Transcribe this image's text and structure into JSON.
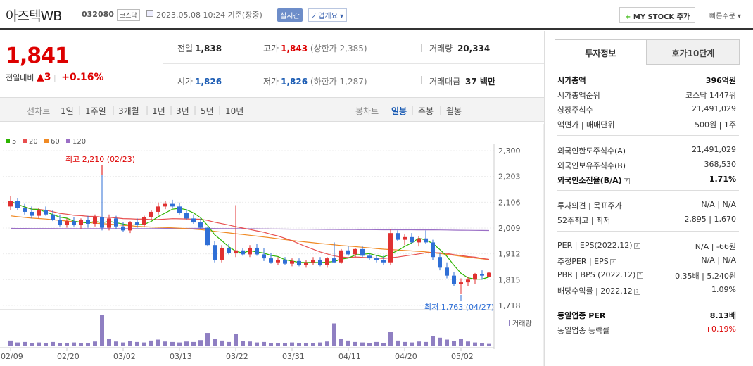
{
  "header": {
    "name": "아즈텍WB",
    "code": "032080",
    "market": "코스닥",
    "timestamp": "2023.05.08 10:24 기준(장중)",
    "realtime": "실시간",
    "company_info": "기업개요",
    "my_stock": "MY STOCK 추가",
    "quick_order": "빠른주문"
  },
  "price": {
    "current": "1,841",
    "change_label": "전일대비",
    "change": "3",
    "change_pct": "+0.16%"
  },
  "quote": {
    "prev_close_label": "전일",
    "prev_close": "1,838",
    "high_label": "고가",
    "high": "1,843",
    "upper_limit": "(상한가 2,385)",
    "volume_label": "거래량",
    "volume": "20,334",
    "open_label": "시가",
    "open": "1,826",
    "low_label": "저가",
    "low": "1,826",
    "lower_limit": "(하한가 1,287)",
    "amount_label": "거래대금",
    "amount": "37 백만"
  },
  "period_bar": {
    "line_label": "선차트",
    "line_periods": [
      "1일",
      "1주일",
      "3개월",
      "1년",
      "3년",
      "5년",
      "10년"
    ],
    "candle_label": "봉차트",
    "candle_periods": [
      "일봉",
      "주봉",
      "월봉"
    ],
    "active_candle": "일봉"
  },
  "chart_data": {
    "type": "candlestick",
    "legend": [
      {
        "name": "5",
        "color": "#2db400"
      },
      {
        "name": "20",
        "color": "#e84f4f"
      },
      {
        "name": "60",
        "color": "#f08a24"
      },
      {
        "name": "120",
        "color": "#9b6fc6"
      }
    ],
    "y_ticks": [
      "2,300",
      "2,203",
      "2,106",
      "2,009",
      "1,912",
      "1,815",
      "1,718"
    ],
    "ylim": [
      1718,
      2300
    ],
    "x_ticks": [
      "02/09",
      "02/20",
      "03/02",
      "03/13",
      "03/22",
      "03/31",
      "04/11",
      "04/20",
      "05/02"
    ],
    "high_annotation": "최고 2,210 (02/23)",
    "low_annotation": "최저 1,763 (04/27)",
    "volume_label": "거래량",
    "candles": [
      [
        2090,
        2130,
        2075,
        2110
      ],
      [
        2110,
        2120,
        2075,
        2085
      ],
      [
        2085,
        2100,
        2060,
        2070
      ],
      [
        2070,
        2090,
        2045,
        2055
      ],
      [
        2055,
        2085,
        2045,
        2075
      ],
      [
        2075,
        2090,
        2055,
        2060
      ],
      [
        2060,
        2075,
        2035,
        2040
      ],
      [
        2040,
        2060,
        2015,
        2020
      ],
      [
        2020,
        2045,
        2010,
        2035
      ],
      [
        2035,
        2050,
        2015,
        2020
      ],
      [
        2020,
        2045,
        2005,
        2040
      ],
      [
        2040,
        2055,
        2010,
        2025
      ],
      [
        2025,
        2060,
        2015,
        2050
      ],
      [
        2050,
        2210,
        2000,
        2010
      ],
      [
        2010,
        2060,
        2000,
        2045
      ],
      [
        2045,
        2055,
        2005,
        2015
      ],
      [
        2015,
        2030,
        1995,
        2000
      ],
      [
        2000,
        2035,
        1990,
        2030
      ],
      [
        2030,
        2045,
        2010,
        2020
      ],
      [
        2020,
        2055,
        2015,
        2050
      ],
      [
        2050,
        2075,
        2040,
        2070
      ],
      [
        2070,
        2105,
        2060,
        2090
      ],
      [
        2090,
        2110,
        2080,
        2100
      ],
      [
        2100,
        2115,
        2085,
        2090
      ],
      [
        2090,
        2105,
        2060,
        2065
      ],
      [
        2065,
        2080,
        2040,
        2045
      ],
      [
        2045,
        2060,
        2025,
        2030
      ],
      [
        2030,
        2045,
        2005,
        2010
      ],
      [
        2010,
        2015,
        1940,
        1945
      ],
      [
        1945,
        1960,
        1880,
        1890
      ],
      [
        1890,
        1945,
        1880,
        1935
      ],
      [
        1935,
        1950,
        1910,
        1915
      ],
      [
        1915,
        2095,
        1900,
        1925
      ],
      [
        1925,
        1935,
        1905,
        1910
      ],
      [
        1910,
        1945,
        1900,
        1935
      ],
      [
        1935,
        1950,
        1905,
        1910
      ],
      [
        1910,
        1935,
        1885,
        1895
      ],
      [
        1895,
        1915,
        1875,
        1880
      ],
      [
        1880,
        1900,
        1870,
        1890
      ],
      [
        1890,
        1900,
        1870,
        1875
      ],
      [
        1875,
        1895,
        1865,
        1885
      ],
      [
        1885,
        1895,
        1865,
        1870
      ],
      [
        1870,
        1890,
        1860,
        1880
      ],
      [
        1880,
        1900,
        1870,
        1890
      ],
      [
        1890,
        1900,
        1865,
        1870
      ],
      [
        1870,
        1900,
        1860,
        1895
      ],
      [
        1895,
        1955,
        1880,
        1880
      ],
      [
        1880,
        1930,
        1875,
        1925
      ],
      [
        1925,
        1940,
        1905,
        1910
      ],
      [
        1910,
        1935,
        1900,
        1930
      ],
      [
        1930,
        1940,
        1900,
        1905
      ],
      [
        1905,
        1915,
        1890,
        1895
      ],
      [
        1895,
        1905,
        1880,
        1890
      ],
      [
        1890,
        1905,
        1870,
        1880
      ],
      [
        1880,
        2005,
        1870,
        1990
      ],
      [
        1990,
        2000,
        1960,
        1965
      ],
      [
        1965,
        1985,
        1945,
        1975
      ],
      [
        1975,
        1990,
        1950,
        1955
      ],
      [
        1955,
        1980,
        1940,
        1970
      ],
      [
        1970,
        2000,
        1950,
        1955
      ],
      [
        1955,
        1965,
        1890,
        1900
      ],
      [
        1900,
        1915,
        1850,
        1860
      ],
      [
        1860,
        1880,
        1820,
        1830
      ],
      [
        1830,
        1845,
        1790,
        1800
      ],
      [
        1800,
        1820,
        1763,
        1805
      ],
      [
        1805,
        1825,
        1790,
        1815
      ],
      [
        1815,
        1840,
        1800,
        1835
      ],
      [
        1835,
        1850,
        1815,
        1830
      ],
      [
        1826,
        1843,
        1826,
        1841
      ]
    ],
    "volume": [
      1.2,
      0.8,
      0.9,
      0.7,
      0.8,
      0.6,
      0.9,
      0.7,
      0.6,
      0.8,
      0.7,
      0.6,
      1.0,
      6.5,
      1.5,
      1.0,
      0.8,
      1.1,
      0.9,
      0.8,
      1.2,
      1.4,
      1.0,
      0.9,
      0.8,
      1.0,
      0.9,
      1.3,
      2.8,
      1.6,
      1.2,
      0.9,
      2.6,
      1.1,
      1.0,
      0.8,
      0.9,
      0.7,
      0.6,
      0.7,
      0.8,
      0.6,
      0.7,
      0.6,
      0.8,
      1.0,
      4.8,
      1.5,
      1.2,
      0.9,
      0.8,
      0.7,
      0.9,
      0.6,
      3.0,
      1.2,
      0.9,
      0.8,
      1.0,
      0.9,
      2.2,
      1.8,
      1.4,
      1.1,
      1.6,
      1.0,
      0.8,
      0.7,
      0.5
    ]
  },
  "invest": {
    "tab1": "투자정보",
    "tab2": "호가10단계",
    "rows1": [
      {
        "k": "시가총액",
        "v": "396억원",
        "bold": true
      },
      {
        "k": "시가총액순위",
        "v": "코스닥 1447위"
      },
      {
        "k": "상장주식수",
        "v": "21,491,029"
      },
      {
        "k": "액면가 | 매매단위",
        "v": "500원 | 1주"
      }
    ],
    "rows2": [
      {
        "k": "외국인한도주식수(A)",
        "v": "21,491,029"
      },
      {
        "k": "외국인보유주식수(B)",
        "v": "368,530"
      },
      {
        "k": "외국인소진율(B/A)",
        "v": "1.71%",
        "bold": true
      }
    ],
    "rows3": [
      {
        "k": "투자의견 | 목표주가",
        "v": "N/A | N/A"
      },
      {
        "k": "52주최고 | 최저",
        "v": "2,895 | 1,670"
      }
    ],
    "rows4": [
      {
        "k": "PER | EPS(2022.12)",
        "v": "N/A | -66원"
      },
      {
        "k": "추정PER | EPS",
        "v": "N/A | N/A"
      },
      {
        "k": "PBR | BPS (2022.12)",
        "v": "0.35배 | 5,240원"
      },
      {
        "k": "배당수익률 | 2022.12",
        "v": "1.09%"
      }
    ],
    "rows5": [
      {
        "k": "동일업종 PER",
        "v": "8.13배",
        "bold": true
      },
      {
        "k": "동일업종 등락률",
        "v": "+0.19%",
        "red": true
      }
    ]
  }
}
